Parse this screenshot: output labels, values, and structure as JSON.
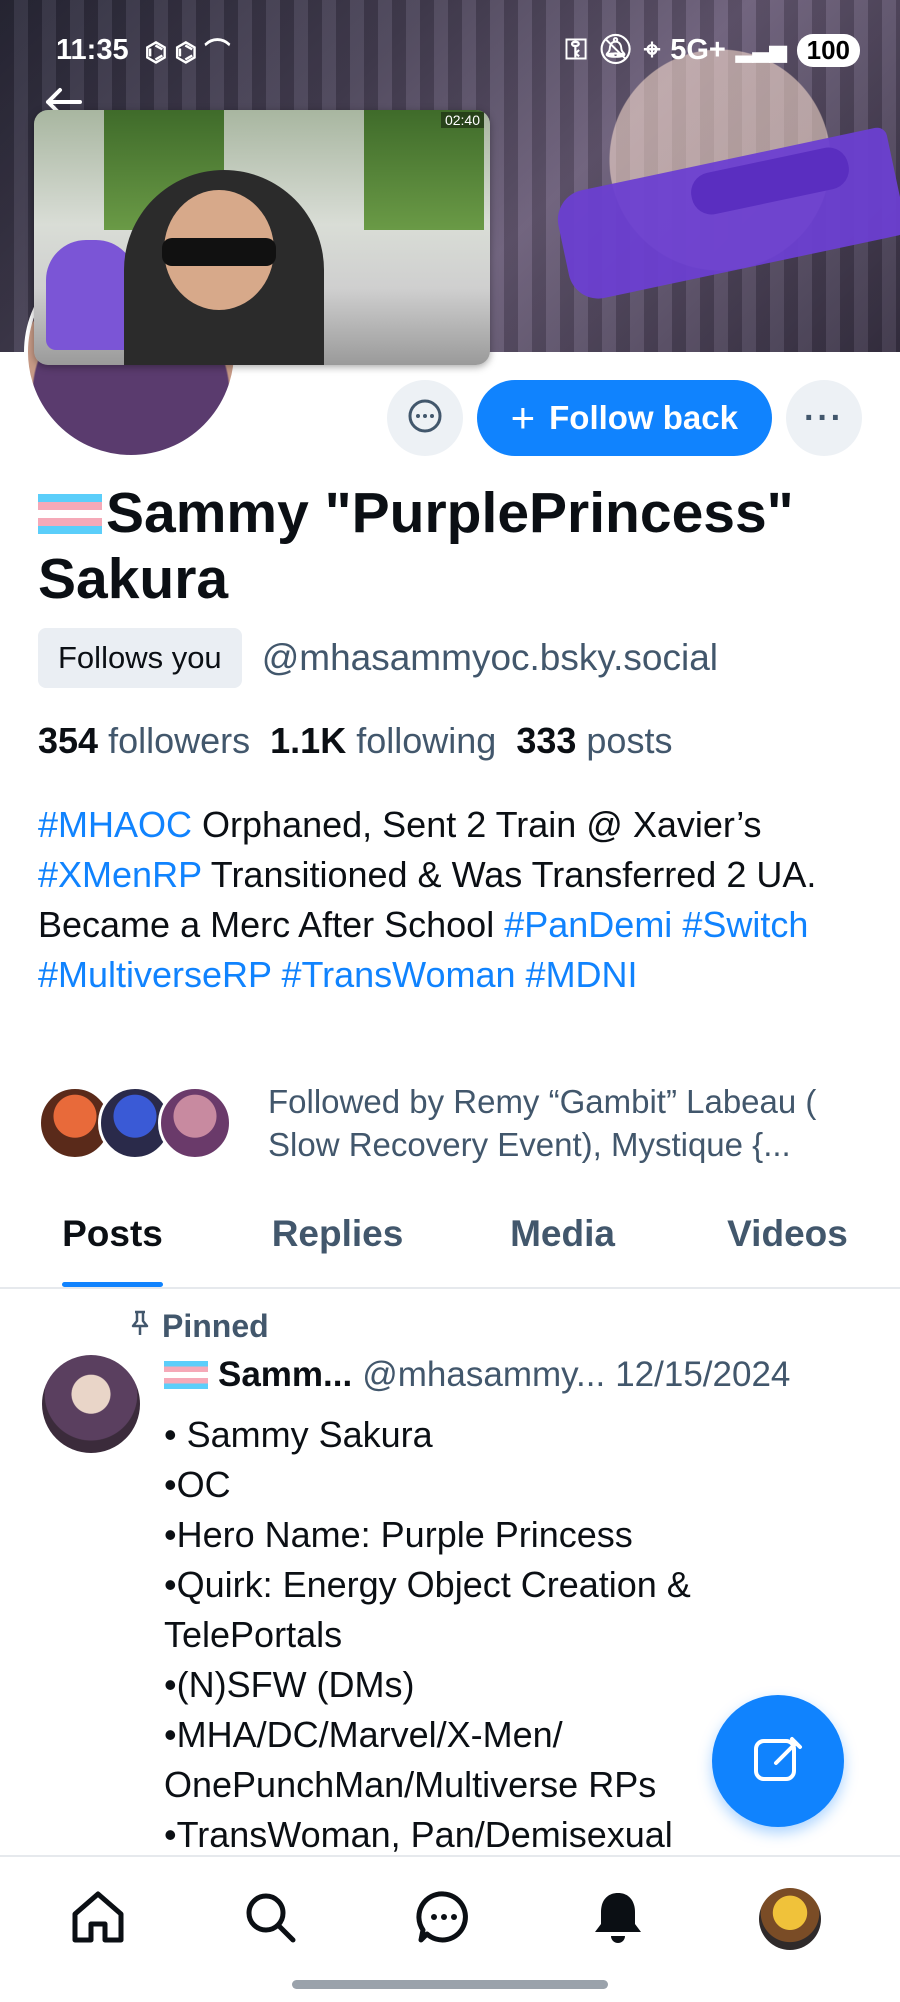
{
  "status_bar": {
    "time": "11:35",
    "network": "5G+",
    "battery": "100"
  },
  "video": {
    "timestamp": "02:40"
  },
  "profile": {
    "follow_label": "Follow back",
    "display_name": "Sammy \"PurplePrincess\" Sakura",
    "follows_you_badge": "Follows you",
    "handle": "@mhasammyoc.bsky.social",
    "followers_count": "354",
    "followers_label": "followers",
    "following_count": "1.1K",
    "following_label": "following",
    "posts_count": "333",
    "posts_label": "posts",
    "bio": {
      "t1": "#MHAOC",
      "p1": " Orphaned, Sent 2 Train @ Xavier’s ",
      "t2": "#XMenRP",
      "p2": " Transitioned & Was Transferred 2 UA. Became a Merc After School ",
      "t3": "#PanDemi",
      "t4": "#Switch",
      "t5": "#MultiverseRP",
      "t6": "#TransWoman",
      "t7": "#MDNI"
    },
    "followed_by": "Followed by Remy “Gambit” Labeau ( Slow Recovery Event), Mystique {..."
  },
  "tabs": [
    "Posts",
    "Replies",
    "Media",
    "Videos"
  ],
  "post": {
    "pinned_label": "Pinned",
    "author": "Samm...",
    "handle": "@mhasammy...",
    "date": "12/15/2024",
    "lines": [
      "• Sammy Sakura",
      "•OC",
      "•Hero Name: Purple Princess",
      "•Quirk: Energy Object Creation & TelePortals",
      "•(N)SFW (DMs)",
      "•MHA/DC/Marvel/X-Men/ OnePunchMan/Multiverse RPs",
      "•TransWoman, Pan/Demisexual"
    ]
  },
  "colors": {
    "accent": "#1083fe",
    "muted": "#42576c",
    "text": "#0b0f14"
  },
  "icons": [
    "back-arrow-icon",
    "chat-icon",
    "plus-icon",
    "more-icon",
    "pin-icon",
    "compose-icon",
    "home-icon",
    "search-icon",
    "messages-icon",
    "bell-icon"
  ]
}
